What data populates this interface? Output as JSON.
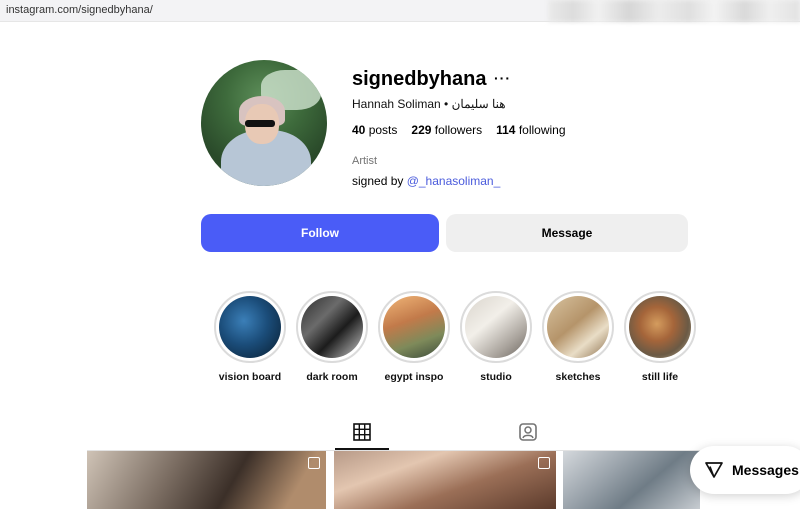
{
  "browser": {
    "url": "instagram.com/signedbyhana/"
  },
  "profile": {
    "username": "signedbyhana",
    "more_label": "···",
    "full_name": "Hannah Soliman • هنا سليمان",
    "stats": {
      "posts_count": "40",
      "posts_label": "posts",
      "followers_count": "229",
      "followers_label": "followers",
      "following_count": "114",
      "following_label": "following"
    },
    "category": "Artist",
    "bio_prefix": "signed by ",
    "bio_mention": "@_hanasoliman_"
  },
  "actions": {
    "follow_label": "Follow",
    "message_label": "Message"
  },
  "highlights": [
    {
      "label": "vision board"
    },
    {
      "label": "dark room"
    },
    {
      "label": "egypt inspo"
    },
    {
      "label": "studio"
    },
    {
      "label": "sketches"
    },
    {
      "label": "still life"
    }
  ],
  "tabs": [
    {
      "name": "posts",
      "icon": "grid-icon",
      "active": true
    },
    {
      "name": "tagged",
      "icon": "tagged-icon",
      "active": false
    }
  ],
  "messages_pill": {
    "label": "Messages",
    "icon": "send-icon"
  },
  "colors": {
    "follow_button": "#4a5cf7",
    "mention_link": "#4a5bdc"
  }
}
